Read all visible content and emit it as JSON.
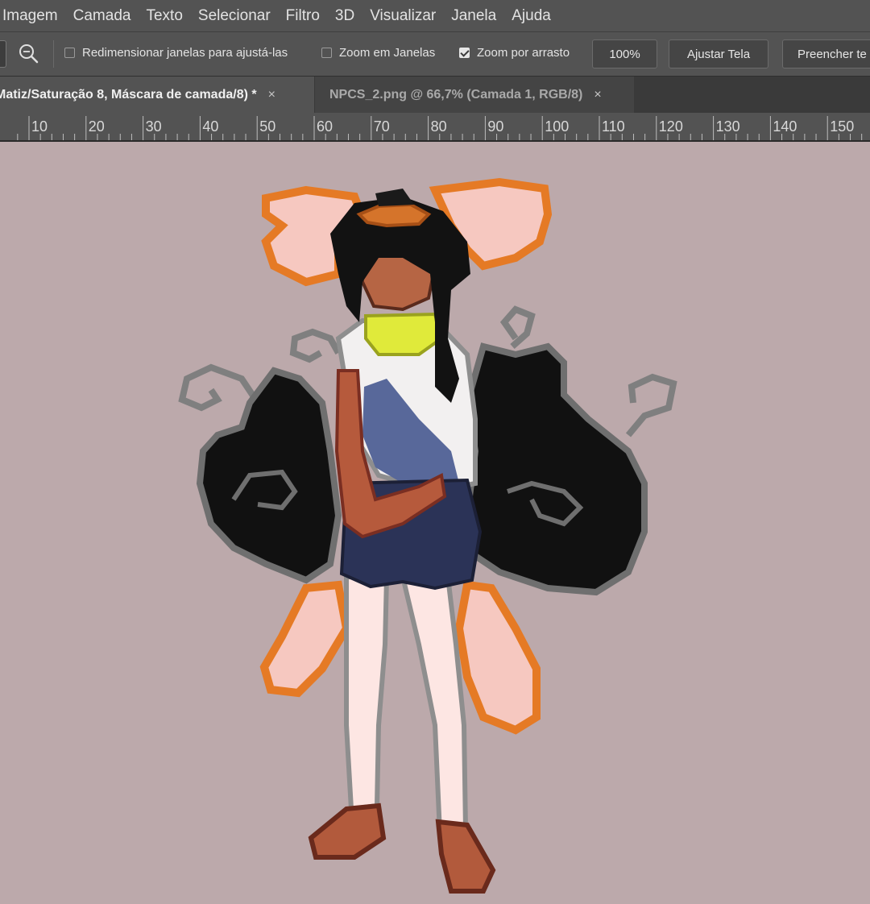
{
  "menu": [
    "Imagem",
    "Camada",
    "Texto",
    "Selecionar",
    "Filtro",
    "3D",
    "Visualizar",
    "Janela",
    "Ajuda"
  ],
  "options": {
    "resize_windows": {
      "label": "Redimensionar janelas para ajustá-las",
      "checked": false
    },
    "zoom_all_windows": {
      "label": "Zoom em Janelas",
      "checked": false
    },
    "scrubby_zoom": {
      "label": "Zoom por arrasto",
      "checked": true
    },
    "zoom_value": "100%",
    "fit_screen": "Ajustar Tela",
    "fill_screen": "Preencher te"
  },
  "tabs": [
    {
      "label": "Matiz/Saturação 8, Máscara de camada/8) *",
      "close": "×",
      "active": true
    },
    {
      "label": "NPCS_2.png @ 66,7% (Camada 1, RGB/8)",
      "close": "×",
      "active": false
    }
  ],
  "ruler": {
    "labels": [
      "10",
      "20",
      "30",
      "40",
      "50",
      "60",
      "70",
      "80",
      "90",
      "100",
      "110",
      "120",
      "130",
      "140",
      "150"
    ]
  },
  "colors": {
    "canvas_bg": "#bca9ab",
    "ui_panel": "#535353",
    "tab_bar": "#3a3a3a"
  }
}
